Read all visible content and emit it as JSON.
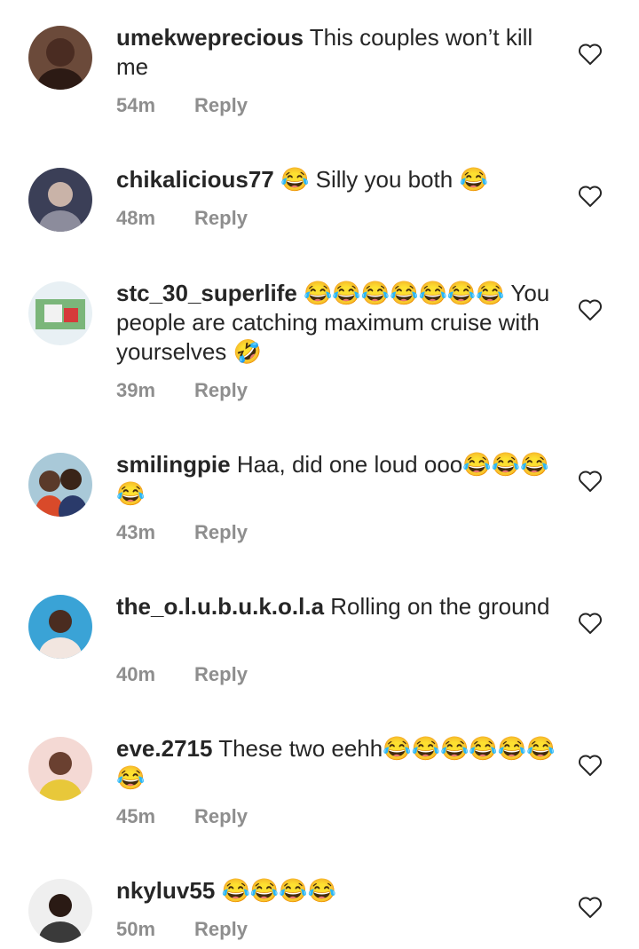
{
  "comments": [
    {
      "username": "umekweprecious",
      "text": "This couples won’t kill me",
      "time": "54m",
      "reply": "Reply",
      "heart_icon": "heart-outline-icon"
    },
    {
      "username": "chikalicious77",
      "text": "😂 Silly you both 😂",
      "time": "48m",
      "reply": "Reply",
      "heart_icon": "heart-outline-icon"
    },
    {
      "username": "stc_30_superlife",
      "text": "😂😂😂😂😂😂😂 You people are catching maximum cruise with yourselves 🤣",
      "time": "39m",
      "reply": "Reply",
      "heart_icon": "heart-outline-icon"
    },
    {
      "username": "smilingpie",
      "text": "Haa, did one loud ooo😂😂😂😂",
      "time": "43m",
      "reply": "Reply",
      "heart_icon": "heart-outline-icon"
    },
    {
      "username": "the_o.l.u.b.u.k.o.l.a",
      "text": "Rolling on the ground",
      "time": "40m",
      "reply": "Reply",
      "heart_icon": "heart-outline-icon"
    },
    {
      "username": "eve.2715",
      "text": "These two eehh😂😂😂😂😂😂😂",
      "time": "45m",
      "reply": "Reply",
      "heart_icon": "heart-outline-icon"
    },
    {
      "username": "nkyluv55",
      "text": "😂😂😂😂",
      "time": "50m",
      "reply": "Reply",
      "heart_icon": "heart-outline-icon"
    }
  ]
}
